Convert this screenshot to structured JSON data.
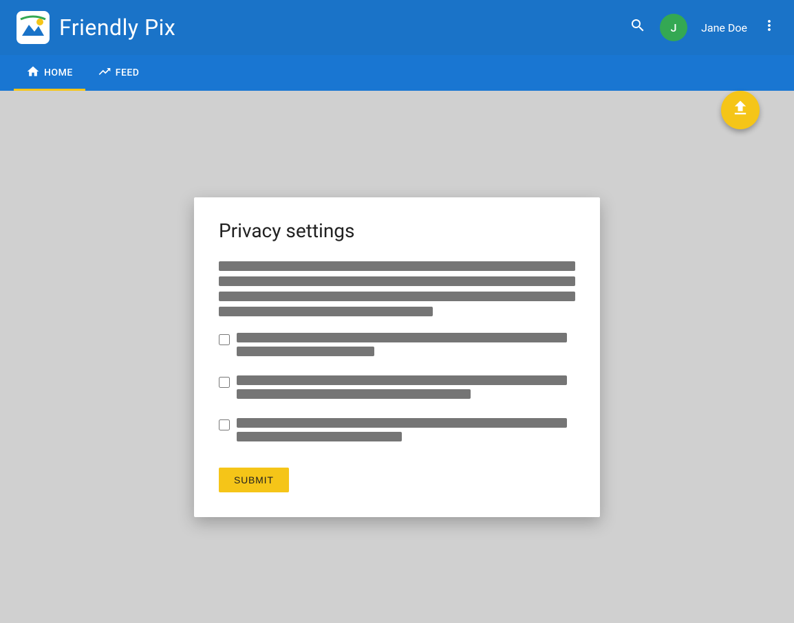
{
  "header": {
    "app_title": "Friendly Pix",
    "user_name": "Jane Doe",
    "user_initials": "J",
    "search_icon": "search",
    "more_icon": "more_vert"
  },
  "navbar": {
    "items": [
      {
        "label": "HOME",
        "icon": "home",
        "active": true
      },
      {
        "label": "FEED",
        "icon": "trending_up",
        "active": false
      }
    ]
  },
  "fab": {
    "icon": "upload",
    "label": "Upload"
  },
  "dialog": {
    "title": "Privacy settings",
    "description_bars": [
      100,
      100,
      100,
      60
    ],
    "checkbox_items": [
      {
        "bar1_width": 100,
        "bar2_width": 40
      },
      {
        "bar1_width": 100,
        "bar2_width": 70
      },
      {
        "bar1_width": 100,
        "bar2_width": 50
      }
    ],
    "submit_label": "SUBMIT"
  },
  "colors": {
    "header_bg": "#1a73c8",
    "navbar_bg": "#1976d2",
    "fab_bg": "#f5c518",
    "active_underline": "#f5c518",
    "avatar_bg": "#34a853"
  }
}
